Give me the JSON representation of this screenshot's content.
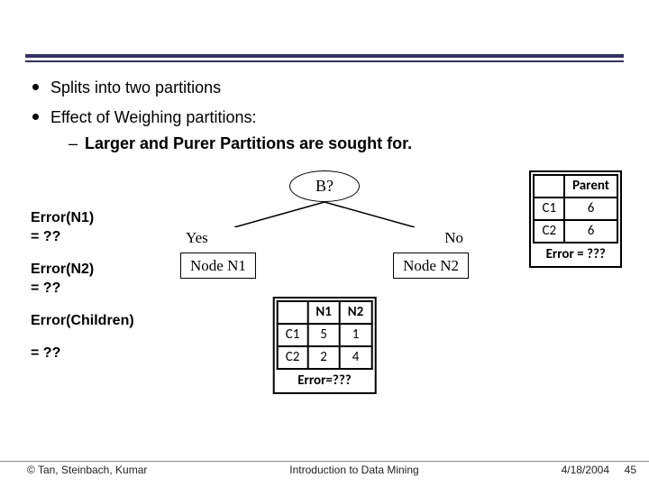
{
  "bullets": {
    "b1": "Splits into two partitions",
    "b2": "Effect of Weighing partitions:",
    "sub_dash": "–",
    "sub": "Larger and Purer Partitions are sought for."
  },
  "tree": {
    "root": "B?",
    "left_label": "Yes",
    "right_label": "No",
    "left_node": "Node N1",
    "right_node": "Node N2"
  },
  "errors": {
    "n1_a": "Error(N1)",
    "n1_b": "= ??",
    "n2_a": "Error(N2)",
    "n2_b": "= ??",
    "ch_a": "Error(Children)",
    "ch_b": "= ??"
  },
  "parent_table": {
    "header_blank": "",
    "header": "Parent",
    "r1c1": "C1",
    "r1c2": "6",
    "r2c1": "C2",
    "r2c2": "6",
    "footer": "Error = ???"
  },
  "children_table": {
    "h_blank": "",
    "h_n1": "N1",
    "h_n2": "N2",
    "r1c1": "C1",
    "r1c2": "5",
    "r1c3": "1",
    "r2c1": "C2",
    "r2c2": "2",
    "r2c3": "4",
    "footer": "Error=???"
  },
  "footer": {
    "left": "© Tan, Steinbach, Kumar",
    "center": "Introduction to Data Mining",
    "date": "4/18/2004",
    "page": "45"
  }
}
